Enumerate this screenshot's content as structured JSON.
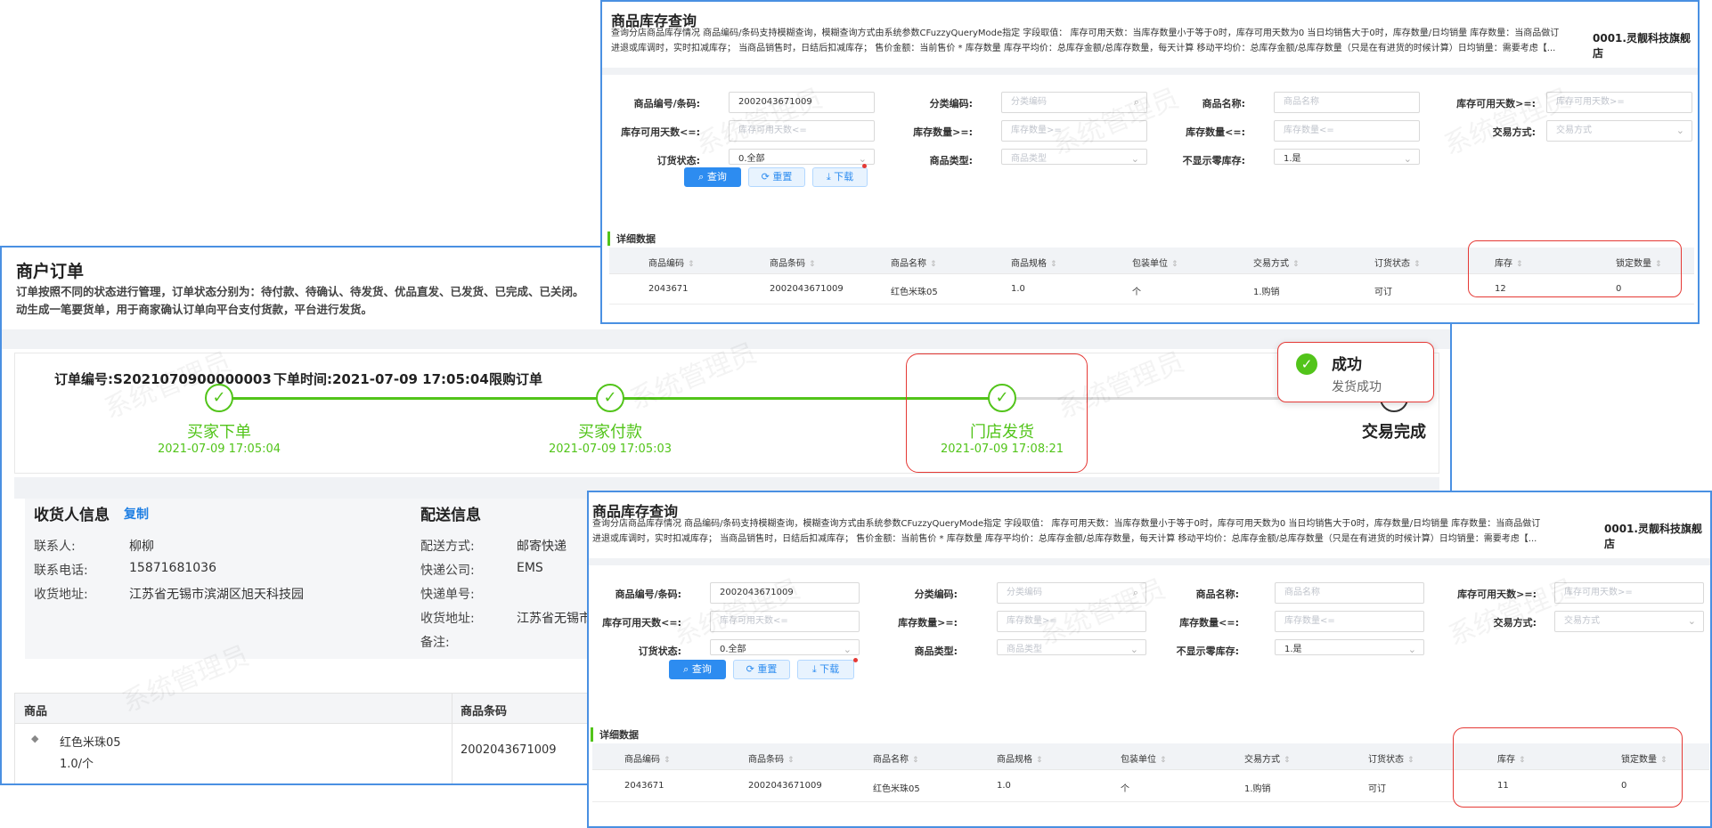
{
  "order": {
    "title": "商户订单",
    "desc1": "订单按照不同的状态进行管理，订单状态分别为：待付款、待确认、待发货、优品直发、已发货、已完成、已关闭。",
    "desc2": "动生成一笔要货单，用于商家确认订单向平台支付货款，平台进行发货。",
    "order_no": "订单编号:S2021070900000003",
    "order_time": "下单时间:2021-07-09 17:05:04",
    "order_type": "限购订单",
    "steps": [
      {
        "label": "买家下单",
        "time": "2021-07-09 17:05:04"
      },
      {
        "label": "买家付款",
        "time": "2021-07-09 17:05:03"
      },
      {
        "label": "门店发货",
        "time": "2021-07-09 17:08:21"
      },
      {
        "label": "交易完成",
        "time": ""
      }
    ],
    "receiver": {
      "heading": "收货人信息",
      "copy": "复制",
      "contact_label": "联系人:",
      "contact": "柳柳",
      "phone_label": "联系电话:",
      "phone": "15871681036",
      "address_label": "收货地址:",
      "address": "江苏省无锡市滨湖区旭天科技园"
    },
    "delivery": {
      "heading": "配送信息",
      "method_label": "配送方式:",
      "method": "邮寄快递",
      "company_label": "快递公司:",
      "company": "EMS",
      "tracking_label": "快递单号:",
      "tracking": "",
      "address_label": "收货地址:",
      "address": "江苏省无锡市",
      "remark_label": "备注:"
    },
    "product_table": {
      "headers": [
        "商品",
        "商品条码"
      ],
      "row": {
        "name": "红色米珠05",
        "spec": "1.0/个",
        "barcode": "2002043671009"
      }
    }
  },
  "toast": {
    "title": "成功",
    "message": "发货成功"
  },
  "watermark": "系统管理员",
  "inventory": {
    "title": "商品库存查询",
    "desc1": "查询分店商品库存情况  商品编码/条码支持模糊查询，模糊查询方式由系统参数CFuzzyQueryMode指定  字段取值：  库存可用天数：当库存数量小于等于0时，库存可用天数为0 当日均销售大于0时，库存数量/日均销量 库存数量：当商品做订",
    "desc2": "进退或库调时，实时扣减库存；  当商品销售时，日结后扣减库存；  售价金额：当前售价 * 库存数量 库存平均价：总库存金额/总库存数量，每天计算 移动平均价：总库存金额/总库存数量（只是在有进货的时候计算）日均销量：需要考虑【...",
    "shop": "0001.灵靓科技旗舰店",
    "filters": {
      "code_label": "商品编号/条码:",
      "code_value": "2002043671009",
      "category_label": "分类编码:",
      "category_ph": "分类编码",
      "name_label": "商品名称:",
      "name_ph": "商品名称",
      "days_ge_label": "库存可用天数>=:",
      "days_ge_ph": "库存可用天数>=",
      "days_le_label": "库存可用天数<=:",
      "days_le_ph": "库存可用天数<=",
      "qty_ge_label": "库存数量>=:",
      "qty_ge_ph": "库存数量>=",
      "qty_le_label": "库存数量<=:",
      "qty_le_ph": "库存数量<=",
      "trade_label": "交易方式:",
      "trade_ph": "交易方式",
      "order_status_label": "订货状态:",
      "order_status_value": "0.全部",
      "type_label": "商品类型:",
      "type_ph": "商品类型",
      "hide_zero_label": "不显示零库存:",
      "hide_zero_value": "1.是"
    },
    "buttons": {
      "query": "查询",
      "reset": "重置",
      "download": "下载"
    },
    "section": "详细数据",
    "headers": [
      "商品编码",
      "商品条码",
      "商品名称",
      "商品规格",
      "包装单位",
      "交易方式",
      "订货状态",
      "库存",
      "锁定数量"
    ],
    "row_top": [
      "2043671",
      "2002043671009",
      "红色米珠05",
      "1.0",
      "个",
      "1.购销",
      "可订",
      "12",
      "0"
    ],
    "row_bottom": [
      "2043671",
      "2002043671009",
      "红色米珠05",
      "1.0",
      "个",
      "1.购销",
      "可订",
      "11",
      "0"
    ]
  }
}
